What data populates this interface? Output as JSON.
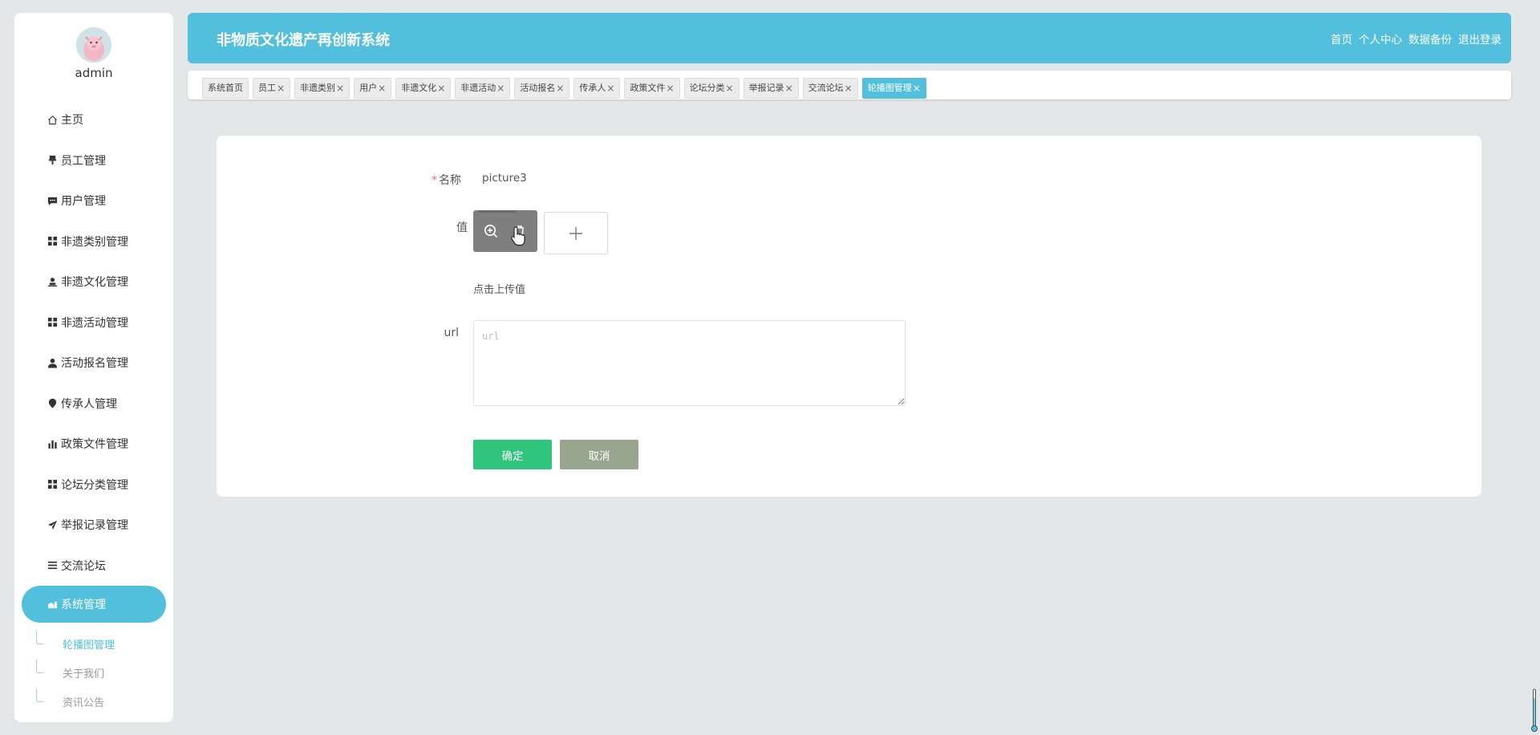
{
  "app": {
    "title": "非物质文化遗产再创新系统",
    "header_nav": [
      "首页",
      "个人中心",
      "数据备份",
      "退出登录"
    ]
  },
  "user": {
    "name": "admin"
  },
  "sidebar": {
    "items": [
      {
        "label": "主页",
        "icon": "home-icon"
      },
      {
        "label": "员工管理",
        "icon": "pin-icon"
      },
      {
        "label": "用户管理",
        "icon": "chat-icon"
      },
      {
        "label": "非遗类别管理",
        "icon": "grid-icon"
      },
      {
        "label": "非遗文化管理",
        "icon": "person-icon"
      },
      {
        "label": "非遗活动管理",
        "icon": "grid-icon"
      },
      {
        "label": "活动报名管理",
        "icon": "user-icon"
      },
      {
        "label": "传承人管理",
        "icon": "location-icon"
      },
      {
        "label": "政策文件管理",
        "icon": "bar-chart-icon"
      },
      {
        "label": "论坛分类管理",
        "icon": "grid-icon"
      },
      {
        "label": "举报记录管理",
        "icon": "send-icon"
      },
      {
        "label": "交流论坛",
        "icon": "list-icon"
      },
      {
        "label": "系统管理",
        "icon": "settings-icon",
        "active": true
      }
    ],
    "subitems": [
      {
        "label": "轮播图管理",
        "active": true
      },
      {
        "label": "关于我们"
      },
      {
        "label": "资讯公告"
      }
    ]
  },
  "tabs": [
    {
      "label": "系统首页",
      "closable": false
    },
    {
      "label": "员工",
      "closable": true
    },
    {
      "label": "非遗类别",
      "closable": true
    },
    {
      "label": "用户",
      "closable": true
    },
    {
      "label": "非遗文化",
      "closable": true
    },
    {
      "label": "非遗活动",
      "closable": true
    },
    {
      "label": "活动报名",
      "closable": true
    },
    {
      "label": "传承人",
      "closable": true
    },
    {
      "label": "政策文件",
      "closable": true
    },
    {
      "label": "论坛分类",
      "closable": true
    },
    {
      "label": "举报记录",
      "closable": true
    },
    {
      "label": "交流论坛",
      "closable": true
    },
    {
      "label": "轮播图管理",
      "closable": true,
      "active": true
    }
  ],
  "tab_close_glyph": "×",
  "form": {
    "name_label": "名称",
    "required_mark": "*",
    "name_value": "picture3",
    "value_label": "值",
    "upload_hint": "点击上传值",
    "url_label": "url",
    "url_placeholder": "url",
    "url_value": "",
    "submit_label": "确定",
    "cancel_label": "取消"
  },
  "colors": {
    "accent": "#52c0dd",
    "background": "#e4e7e7",
    "submit": "#2fc57c",
    "cancel": "#99a68f",
    "required": "#f56c6c"
  }
}
